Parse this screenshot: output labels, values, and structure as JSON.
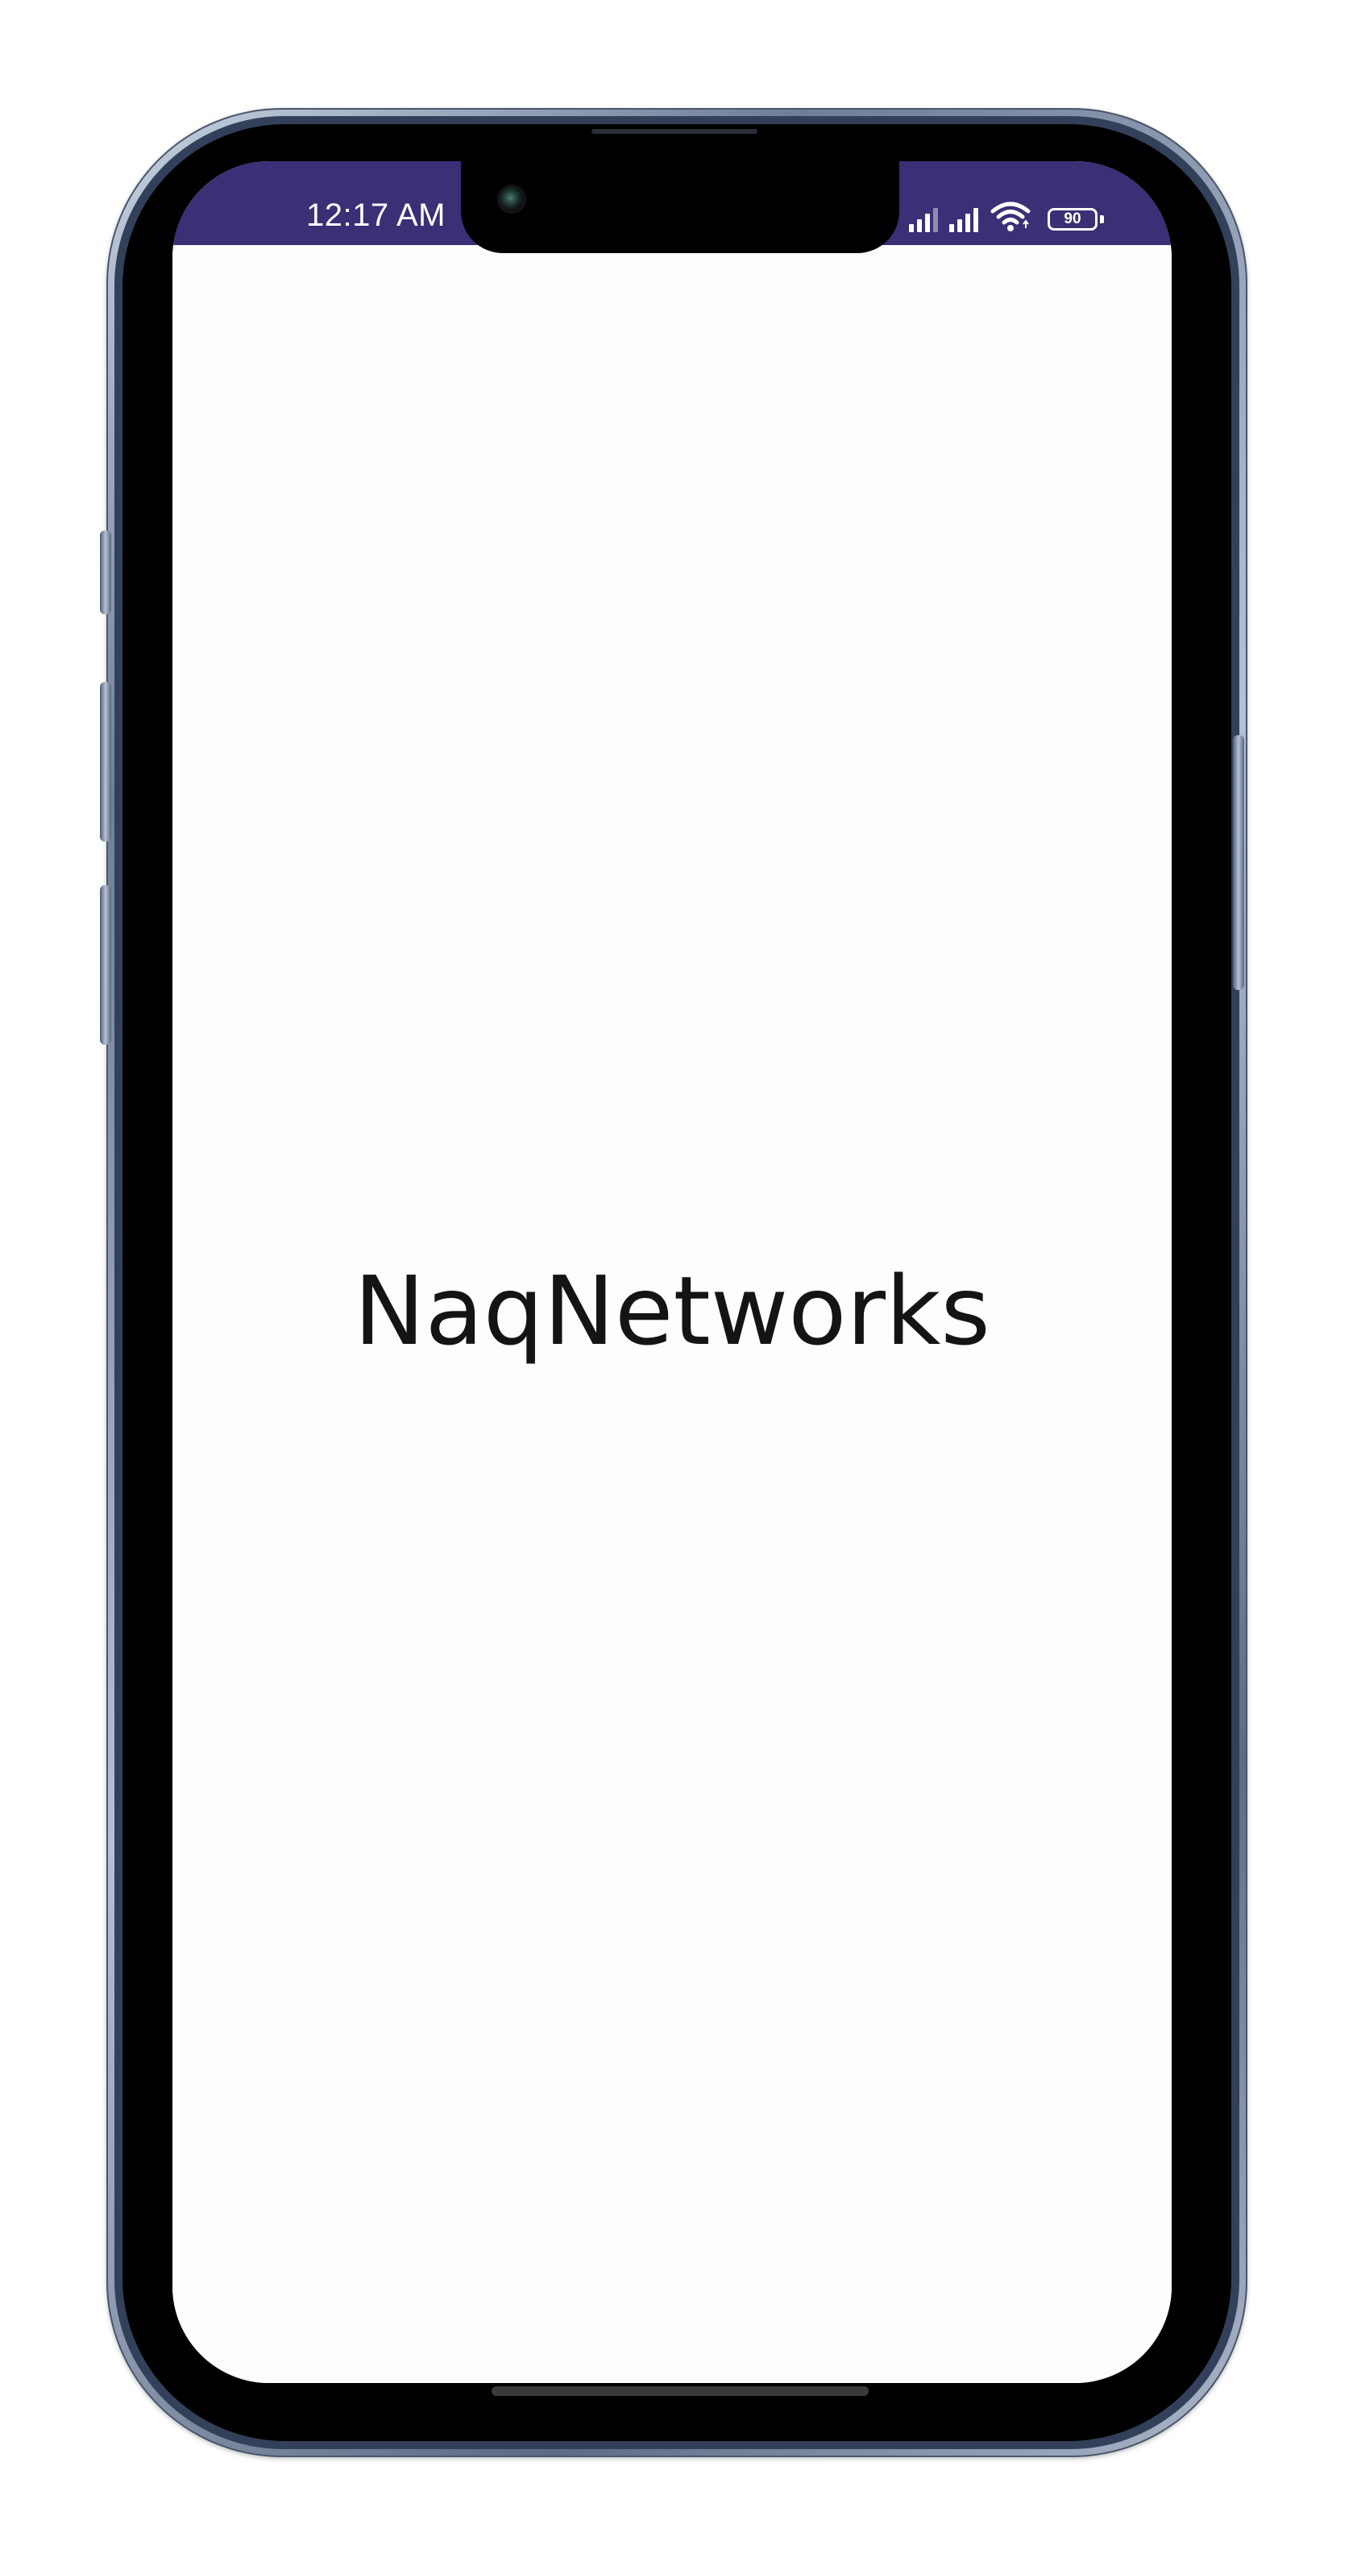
{
  "status_bar": {
    "time": "12:17 AM",
    "background_color": "#3b2f76",
    "icons": [
      "signal-icon",
      "signal-icon",
      "wifi-icon",
      "battery-icon"
    ],
    "battery_level": "90"
  },
  "app": {
    "title": "NaqNetworks",
    "background_color": "#fdfdfd"
  }
}
